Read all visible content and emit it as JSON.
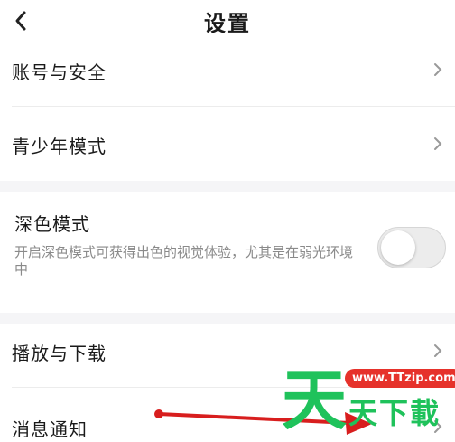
{
  "header": {
    "title": "设置",
    "back_icon": "chevron-left-icon"
  },
  "rows": {
    "account": {
      "label": "账号与安全"
    },
    "youth": {
      "label": "青少年模式"
    },
    "dark": {
      "label": "深色模式",
      "description": "开启深色模式可获得出色的视觉体验，尤其是在弱光环境中",
      "enabled": false
    },
    "playback": {
      "label": "播放与下载"
    },
    "notify": {
      "label": "消息通知"
    }
  },
  "watermark": {
    "url": "www.TTzip.com",
    "big_char": "天",
    "text": "天下載"
  },
  "colors": {
    "section_gap": "#f5f5f7",
    "arrow": "#d81e1e",
    "watermark_green": "#1fc25b",
    "watermark_red": "#e6322b"
  }
}
